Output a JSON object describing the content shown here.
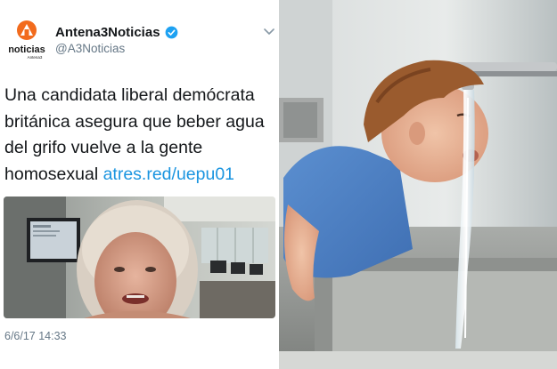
{
  "tweet": {
    "account_name": "Antena3Noticias",
    "handle": "@A3Noticias",
    "logo_text": "noticias",
    "logo_subtext": "Antena3",
    "text": "Una candidata liberal demócrata británica asegura que beber agua del grifo vuelve a la gente homosexual ",
    "link": "atres.red/uepu01",
    "timestamp": "6/6/17 14:33"
  },
  "icons": {
    "verified": "verified-badge-icon",
    "more": "chevron-down-icon"
  },
  "colors": {
    "brand_orange": "#f26b1d",
    "link_blue": "#1b95e0",
    "verified_blue": "#1da1f2",
    "text_dark": "#14171a",
    "text_gray": "#657786"
  }
}
